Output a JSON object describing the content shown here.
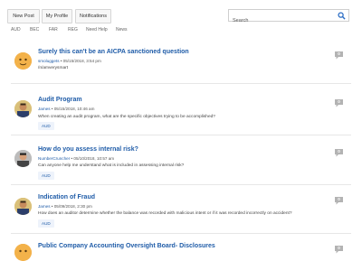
{
  "toolbar": {
    "new_post": "New Post",
    "my_profile": "My Profile",
    "notifications": "Notifications",
    "search_placeholder": "Search"
  },
  "categories": [
    "AUD",
    "BEC",
    "FAR",
    "REG",
    "Need Help",
    "News"
  ],
  "posts": [
    {
      "title": "Surely this can't be an AICPA sanctioned question",
      "author": "smoluggets",
      "date": "05/15/2018, 3:54 pm",
      "body": "/n/amverysmart",
      "tag": "",
      "replies": "0"
    },
    {
      "title": "Audit Program",
      "author": "James",
      "date": "05/15/2018, 10:46 am",
      "body": "When creating an audit program, what are the specific objectives trying to be accomplished?",
      "tag": "AUD",
      "replies": "0"
    },
    {
      "title": "How do you assess internal risk?",
      "author": "NumberCruncher",
      "date": "05/10/2018, 10:57 am",
      "body": "Can anyone help me understand what is included in assessing internal risk?",
      "tag": "AUD",
      "replies": "0"
    },
    {
      "title": "Indication of Fraud",
      "author": "James",
      "date": "05/09/2018, 2:30 pm",
      "body": "How does an auditor determine whether the balance was recorded with malicious intent or if it was recorded incorrectly on accident?",
      "tag": "AUD",
      "replies": "0"
    },
    {
      "title": "Public Company Accounting Oversight Board- Disclosures",
      "author": "",
      "date": "",
      "body": "",
      "tag": "",
      "replies": "0"
    }
  ],
  "colors": {
    "link": "#1f5ca8",
    "accent_icon": "#2a6cc4",
    "bubble": "#b3b3b3"
  }
}
